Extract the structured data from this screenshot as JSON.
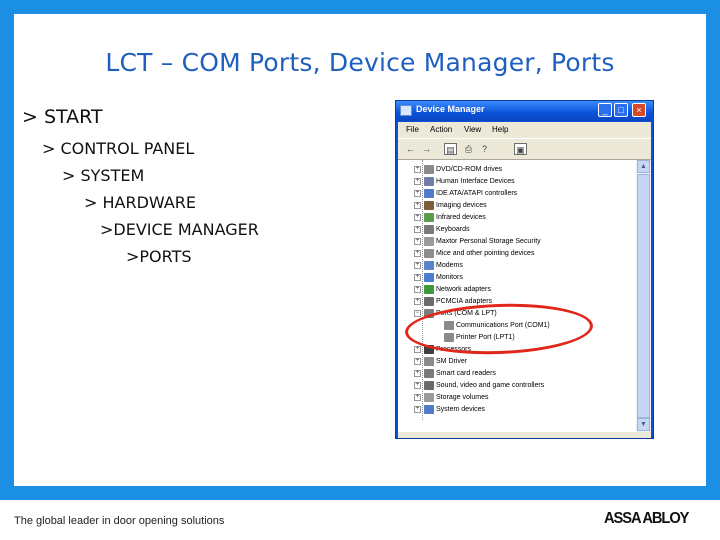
{
  "slide": {
    "title": "LCT – COM Ports, Device Manager, Ports",
    "bullets": [
      "> START",
      "> CONTROL PANEL",
      "> SYSTEM",
      "> HARDWARE",
      ">DEVICE MANAGER",
      ">PORTS"
    ]
  },
  "window": {
    "title": "Device Manager",
    "controls": {
      "minimize": "_",
      "maximize": "□",
      "close": "×"
    },
    "menu": [
      "File",
      "Action",
      "View",
      "Help"
    ],
    "toolbar_icons": [
      "back-icon",
      "forward-icon",
      "properties-icon",
      "print-icon",
      "help-icon",
      "scan-hardware-icon"
    ],
    "tree": [
      {
        "label": "DVD/CD-ROM drives",
        "expander": "+",
        "icon": "dvd-icon",
        "color": "#8a8a8a"
      },
      {
        "label": "Human Interface Devices",
        "expander": "+",
        "icon": "hid-icon",
        "color": "#6f7fa6"
      },
      {
        "label": "IDE ATA/ATAPI controllers",
        "expander": "+",
        "icon": "ide-icon",
        "color": "#4f7bc8"
      },
      {
        "label": "Imaging devices",
        "expander": "+",
        "icon": "camera-icon",
        "color": "#7b5f3a"
      },
      {
        "label": "Infrared devices",
        "expander": "+",
        "icon": "infrared-icon",
        "color": "#5b9b4b"
      },
      {
        "label": "Keyboards",
        "expander": "+",
        "icon": "keyboard-icon",
        "color": "#7a7a7a"
      },
      {
        "label": "Maxtor Personal Storage Security",
        "expander": "+",
        "icon": "storage-icon",
        "color": "#9a9a9a"
      },
      {
        "label": "Mice and other pointing devices",
        "expander": "+",
        "icon": "mouse-icon",
        "color": "#8d8d8d"
      },
      {
        "label": "Modems",
        "expander": "+",
        "icon": "modem-icon",
        "color": "#5a84c9"
      },
      {
        "label": "Monitors",
        "expander": "+",
        "icon": "monitor-icon",
        "color": "#4a7ccf"
      },
      {
        "label": "Network adapters",
        "expander": "+",
        "icon": "network-icon",
        "color": "#3d9b3d"
      },
      {
        "label": "PCMCIA adapters",
        "expander": "+",
        "icon": "pcmcia-icon",
        "color": "#6b6b6b"
      },
      {
        "label": "Ports (COM & LPT)",
        "expander": "−",
        "icon": "ports-icon",
        "color": "#7d7d7d"
      },
      {
        "label": "Communications Port (COM1)",
        "sub": true,
        "icon": "com-port-icon",
        "color": "#8a8a8a"
      },
      {
        "label": "Printer Port (LPT1)",
        "sub": true,
        "icon": "printer-port-icon",
        "color": "#8a8a8a"
      },
      {
        "label": "Processors",
        "expander": "+",
        "icon": "processor-icon",
        "color": "#3f3f3f"
      },
      {
        "label": "SM Driver",
        "expander": "+",
        "icon": "driver-icon",
        "color": "#8a8a8a"
      },
      {
        "label": "Smart card readers",
        "expander": "+",
        "icon": "smart-card-icon",
        "color": "#7a7a7a"
      },
      {
        "label": "Sound, video and game controllers",
        "expander": "+",
        "icon": "sound-icon",
        "color": "#6a6a6a"
      },
      {
        "label": "Storage volumes",
        "expander": "+",
        "icon": "storage-volume-icon",
        "color": "#9a9a9a"
      },
      {
        "label": "System devices",
        "expander": "+",
        "icon": "system-icon",
        "color": "#4f7bc8"
      }
    ]
  },
  "footer": {
    "tagline": "The global leader in door opening solutions",
    "logo": "ASSA ABLOY"
  },
  "colors": {
    "accent": "#1a8fe3",
    "title": "#1f5fbf",
    "highlight": "#e1261c"
  }
}
